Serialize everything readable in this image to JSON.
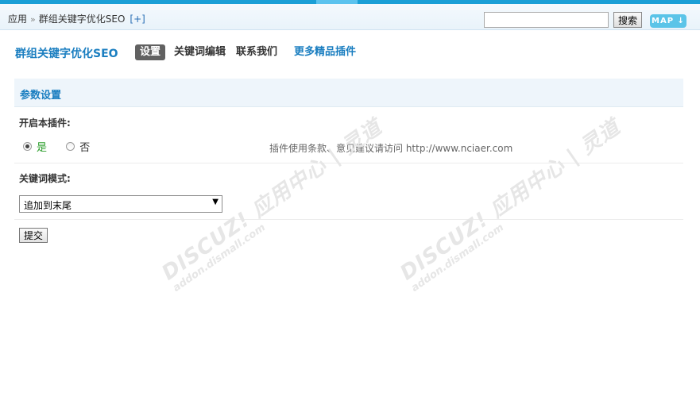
{
  "header": {
    "breadcrumb_root": "应用",
    "breadcrumb_sep": "»",
    "breadcrumb_current": "群组关键字优化SEO",
    "add_link": "[+]",
    "search_placeholder": "",
    "search_button": "搜索",
    "map_button": "MAP ↓"
  },
  "plugin": {
    "title": "群组关键字优化SEO",
    "tabs": [
      {
        "label": "设置",
        "active": true
      },
      {
        "label": "关键词编辑",
        "active": false
      },
      {
        "label": "联系我们",
        "active": false
      },
      {
        "label": "更多精品插件",
        "active": false
      }
    ]
  },
  "section": {
    "title": "参数设置",
    "enable_label": "开启本插件:",
    "yes_label": "是",
    "no_label": "否",
    "enable_value": "是",
    "notice": "插件使用条款、意见建议请访问 http://www.nciaer.com",
    "mode_label": "关键词模式:",
    "mode_value": "追加到末尾",
    "submit_label": "提交"
  },
  "watermark": {
    "brand": "DISCUZ! 应用中心 | 灵道",
    "url": "addon.dismall.com"
  },
  "colors": {
    "accent": "#1a9fd6",
    "link": "#1a7ec0",
    "active_tab_bg": "#616161",
    "yes_green": "#2a9d2a"
  }
}
